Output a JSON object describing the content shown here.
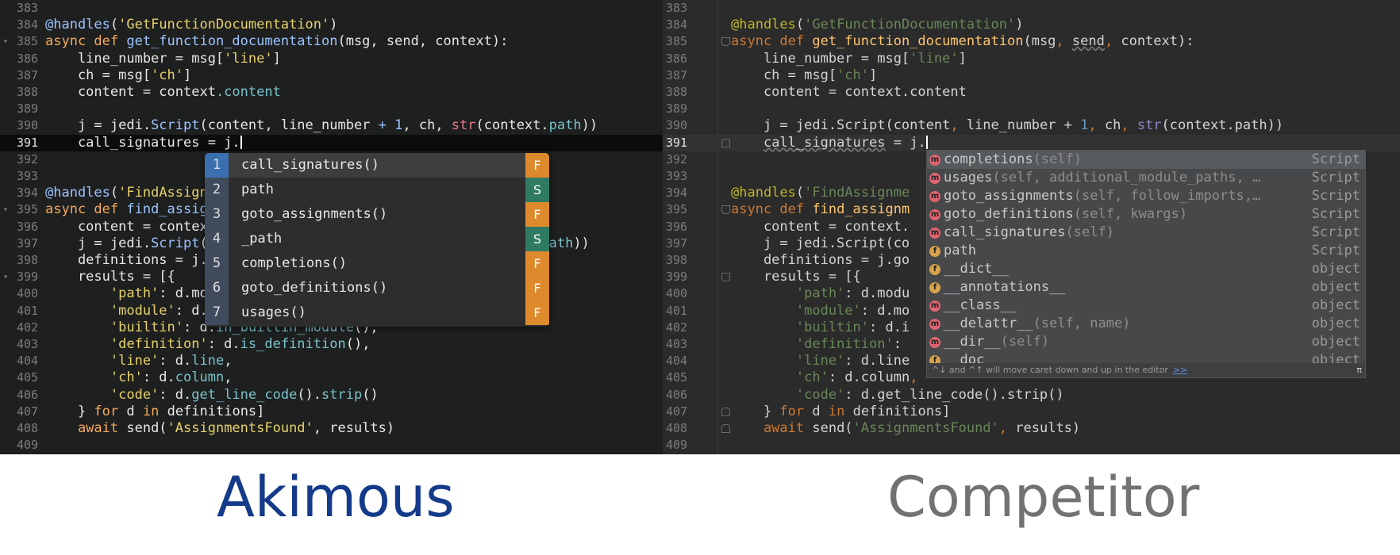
{
  "left": {
    "lines": [
      {
        "n": "383",
        "code": []
      },
      {
        "n": "384",
        "code": [
          [
            "dec",
            "@handles"
          ],
          [
            "t",
            "("
          ],
          [
            "str",
            "'GetFunctionDocumentation'"
          ],
          [
            "t",
            ")"
          ]
        ]
      },
      {
        "n": "385",
        "fold": true,
        "code": [
          [
            "kw",
            "async def "
          ],
          [
            "fn",
            "get_function_documentation"
          ],
          [
            "t",
            "(msg, send, context):"
          ]
        ]
      },
      {
        "n": "386",
        "code": [
          [
            "t",
            "    line_number = msg["
          ],
          [
            "str",
            "'line'"
          ],
          [
            "t",
            "]"
          ]
        ]
      },
      {
        "n": "387",
        "code": [
          [
            "t",
            "    ch = msg["
          ],
          [
            "str",
            "'ch'"
          ],
          [
            "t",
            "]"
          ]
        ]
      },
      {
        "n": "388",
        "code": [
          [
            "t",
            "    content = context"
          ],
          [
            "attr",
            ".content"
          ]
        ]
      },
      {
        "n": "389",
        "code": []
      },
      {
        "n": "390",
        "code": [
          [
            "t",
            "    j = jedi."
          ],
          [
            "fn",
            "Script"
          ],
          [
            "t",
            "(content, line_number "
          ],
          [
            "num",
            "+ 1"
          ],
          [
            "t",
            ", ch, "
          ],
          [
            "bi",
            "str"
          ],
          [
            "t",
            "(context."
          ],
          [
            "attr",
            "path"
          ],
          [
            "t",
            "))"
          ]
        ]
      },
      {
        "n": "391",
        "current": true,
        "code": [
          [
            "t",
            "    call_signatures = j."
          ]
        ]
      },
      {
        "n": "392",
        "code": []
      },
      {
        "n": "393",
        "code": []
      },
      {
        "n": "394",
        "code": [
          [
            "dec",
            "@handles"
          ],
          [
            "t",
            "("
          ],
          [
            "str",
            "'FindAssign"
          ]
        ]
      },
      {
        "n": "395",
        "fold": true,
        "code": [
          [
            "kw",
            "async def "
          ],
          [
            "fn",
            "find_assig"
          ]
        ]
      },
      {
        "n": "396",
        "code": [
          [
            "t",
            "    content = contex"
          ]
        ]
      },
      {
        "n": "397",
        "code": [
          [
            "t",
            "    j = jedi."
          ],
          [
            "fn",
            "Script"
          ],
          [
            "t",
            "(                                  ontext."
          ],
          [
            "attr",
            "path"
          ],
          [
            "t",
            "))"
          ]
        ]
      },
      {
        "n": "398",
        "code": [
          [
            "t",
            "    definitions = j."
          ]
        ]
      },
      {
        "n": "399",
        "fold": true,
        "code": [
          [
            "t",
            "    results = [{"
          ]
        ]
      },
      {
        "n": "400",
        "code": [
          [
            "str",
            "        'path'"
          ],
          [
            "t",
            ": d.mo"
          ]
        ]
      },
      {
        "n": "401",
        "code": [
          [
            "str",
            "        'module'"
          ],
          [
            "t",
            ": d."
          ]
        ]
      },
      {
        "n": "402",
        "code": [
          [
            "str",
            "        'builtin'"
          ],
          [
            "t",
            ": d."
          ],
          [
            "attr",
            "in_builtin_module"
          ],
          [
            "t",
            "(),"
          ]
        ]
      },
      {
        "n": "403",
        "code": [
          [
            "str",
            "        'definition'"
          ],
          [
            "t",
            ": d."
          ],
          [
            "attr",
            "is_definition"
          ],
          [
            "t",
            "(),"
          ]
        ]
      },
      {
        "n": "404",
        "code": [
          [
            "str",
            "        'line'"
          ],
          [
            "t",
            ": d."
          ],
          [
            "attr",
            "line"
          ],
          [
            "t",
            ","
          ]
        ]
      },
      {
        "n": "405",
        "code": [
          [
            "str",
            "        'ch'"
          ],
          [
            "t",
            ": d."
          ],
          [
            "attr",
            "column"
          ],
          [
            "t",
            ","
          ]
        ]
      },
      {
        "n": "406",
        "code": [
          [
            "str",
            "        'code'"
          ],
          [
            "t",
            ": d."
          ],
          [
            "attr",
            "get_line_code"
          ],
          [
            "t",
            "()."
          ],
          [
            "attr",
            "strip"
          ],
          [
            "t",
            "()"
          ]
        ]
      },
      {
        "n": "407",
        "code": [
          [
            "t",
            "    } "
          ],
          [
            "kw",
            "for"
          ],
          [
            "t",
            " d "
          ],
          [
            "kw",
            "in"
          ],
          [
            "t",
            " definitions]"
          ]
        ]
      },
      {
        "n": "408",
        "code": [
          [
            "kw",
            "    await "
          ],
          [
            "t",
            "send("
          ],
          [
            "str",
            "'AssignmentsFound'"
          ],
          [
            "t",
            ", results)"
          ]
        ]
      },
      {
        "n": "409",
        "code": []
      }
    ],
    "popup": [
      {
        "num": "1",
        "label": "call_signatures()",
        "type": "F",
        "selected": true
      },
      {
        "num": "2",
        "label": "path",
        "type": "S"
      },
      {
        "num": "3",
        "label": "goto_assignments()",
        "type": "F"
      },
      {
        "num": "4",
        "label": "_path",
        "type": "S"
      },
      {
        "num": "5",
        "label": "completions()",
        "type": "F"
      },
      {
        "num": "6",
        "label": "goto_definitions()",
        "type": "F"
      },
      {
        "num": "7",
        "label": "usages()",
        "type": "F"
      }
    ],
    "type_colors": {
      "F": "#dd8a2c",
      "S": "#2f7a63"
    }
  },
  "right": {
    "lines": [
      {
        "n": "383",
        "code": []
      },
      {
        "n": "384",
        "code": [
          [
            "dec-r",
            "@handles"
          ],
          [
            "t",
            "("
          ],
          [
            "str-r",
            "'GetFunctionDocumentation'"
          ],
          [
            "t",
            ")"
          ]
        ]
      },
      {
        "n": "385",
        "fold": "down",
        "code": [
          [
            "kw-r",
            "async def "
          ],
          [
            "fn-r",
            "get_function_documentation"
          ],
          [
            "t",
            "(msg"
          ],
          [
            "kw-r",
            ", "
          ],
          [
            "under",
            "send"
          ],
          [
            "kw-r",
            ", "
          ],
          [
            "t",
            "context):"
          ]
        ]
      },
      {
        "n": "386",
        "code": [
          [
            "t",
            "    line_number = msg["
          ],
          [
            "str-r",
            "'line'"
          ],
          [
            "t",
            "]"
          ]
        ]
      },
      {
        "n": "387",
        "code": [
          [
            "t",
            "    ch = msg["
          ],
          [
            "str-r",
            "'ch'"
          ],
          [
            "t",
            "]"
          ]
        ]
      },
      {
        "n": "388",
        "code": [
          [
            "t",
            "    content = context.content"
          ]
        ]
      },
      {
        "n": "389",
        "code": []
      },
      {
        "n": "390",
        "code": [
          [
            "t",
            "    j = jedi.Script(content"
          ],
          [
            "kw-r",
            ", "
          ],
          [
            "t",
            "line_number + "
          ],
          [
            "num-r",
            "1"
          ],
          [
            "kw-r",
            ", "
          ],
          [
            "t",
            "ch"
          ],
          [
            "kw-r",
            ", "
          ],
          [
            "bi-r",
            "str"
          ],
          [
            "t",
            "(context.path))"
          ]
        ]
      },
      {
        "n": "391",
        "current": true,
        "fold": "up",
        "code": [
          [
            "t",
            "    "
          ],
          [
            "under",
            "call_signatures"
          ],
          [
            "t",
            " = j."
          ]
        ]
      },
      {
        "n": "392",
        "code": []
      },
      {
        "n": "393",
        "code": []
      },
      {
        "n": "394",
        "code": [
          [
            "dec-r",
            "@handles"
          ],
          [
            "t",
            "("
          ],
          [
            "str-r",
            "'FindAssignme"
          ]
        ]
      },
      {
        "n": "395",
        "fold": "down",
        "code": [
          [
            "kw-r",
            "async def "
          ],
          [
            "fn-r",
            "find_assignm"
          ]
        ]
      },
      {
        "n": "396",
        "code": [
          [
            "t",
            "    content = context."
          ]
        ]
      },
      {
        "n": "397",
        "code": [
          [
            "t",
            "    j = jedi.Script(co                                       h))"
          ]
        ]
      },
      {
        "n": "398",
        "code": [
          [
            "t",
            "    definitions = j.go"
          ]
        ]
      },
      {
        "n": "399",
        "fold": "down",
        "code": [
          [
            "t",
            "    results = [{"
          ]
        ]
      },
      {
        "n": "400",
        "code": [
          [
            "str-r",
            "        'path'"
          ],
          [
            "t",
            ": d.modu"
          ]
        ]
      },
      {
        "n": "401",
        "code": [
          [
            "str-r",
            "        'module'"
          ],
          [
            "t",
            ": d.mo"
          ]
        ]
      },
      {
        "n": "402",
        "code": [
          [
            "str-r",
            "        'builtin'"
          ],
          [
            "t",
            ": d.i"
          ]
        ]
      },
      {
        "n": "403",
        "code": [
          [
            "str-r",
            "        'definition'"
          ],
          [
            "t",
            ": "
          ]
        ]
      },
      {
        "n": "404",
        "code": [
          [
            "str-r",
            "        'line'"
          ],
          [
            "t",
            ": d.line"
          ]
        ]
      },
      {
        "n": "405",
        "code": [
          [
            "str-r",
            "        'ch'"
          ],
          [
            "t",
            ": d.column"
          ],
          [
            "kw-r",
            ","
          ]
        ]
      },
      {
        "n": "406",
        "code": [
          [
            "str-r",
            "        'code'"
          ],
          [
            "t",
            ": d.get_line_code().strip()"
          ]
        ]
      },
      {
        "n": "407",
        "fold": "up",
        "code": [
          [
            "t",
            "    } "
          ],
          [
            "kw-r",
            "for"
          ],
          [
            "t",
            " d "
          ],
          [
            "kw-r",
            "in"
          ],
          [
            "t",
            " definitions]"
          ]
        ]
      },
      {
        "n": "408",
        "fold": "up",
        "code": [
          [
            "kw-r",
            "    await "
          ],
          [
            "t",
            "send("
          ],
          [
            "str-r",
            "'AssignmentsFound'"
          ],
          [
            "kw-r",
            ", "
          ],
          [
            "t",
            "results)"
          ]
        ]
      },
      {
        "n": "409",
        "code": []
      }
    ],
    "popup": [
      {
        "icon": "m",
        "name": "completions",
        "args": "(self)",
        "type": "Script",
        "selected": true
      },
      {
        "icon": "m",
        "name": "usages",
        "args": "(self, additional_module_paths, …",
        "type": "Script"
      },
      {
        "icon": "m",
        "name": "goto_assignments",
        "args": "(self, follow_imports,…",
        "type": "Script"
      },
      {
        "icon": "m",
        "name": "goto_definitions",
        "args": "(self, kwargs)",
        "type": "Script"
      },
      {
        "icon": "m",
        "name": "call_signatures",
        "args": "(self)",
        "type": "Script"
      },
      {
        "icon": "f",
        "name": "path",
        "args": "",
        "type": "Script"
      },
      {
        "icon": "f",
        "name": "__dict__",
        "args": "",
        "type": "object"
      },
      {
        "icon": "f",
        "name": "__annotations__",
        "args": "",
        "type": "object"
      },
      {
        "icon": "m",
        "name": "__class__",
        "args": "",
        "type": "object"
      },
      {
        "icon": "m",
        "name": "__delattr__",
        "args": "(self, name)",
        "type": "object"
      },
      {
        "icon": "m",
        "name": "__dir__",
        "args": "(self)",
        "type": "object"
      },
      {
        "icon": "f",
        "name": "__doc__",
        "args": "",
        "type": "object"
      }
    ],
    "icon_colors": {
      "m": "#e0646f",
      "f": "#d8a24a"
    },
    "hint": "^↓ and ^↑ will move caret down and up in the editor",
    "hint_link": ">>",
    "hint_pi": "π"
  },
  "captions": {
    "left": "Akimous",
    "right": "Competitor"
  }
}
